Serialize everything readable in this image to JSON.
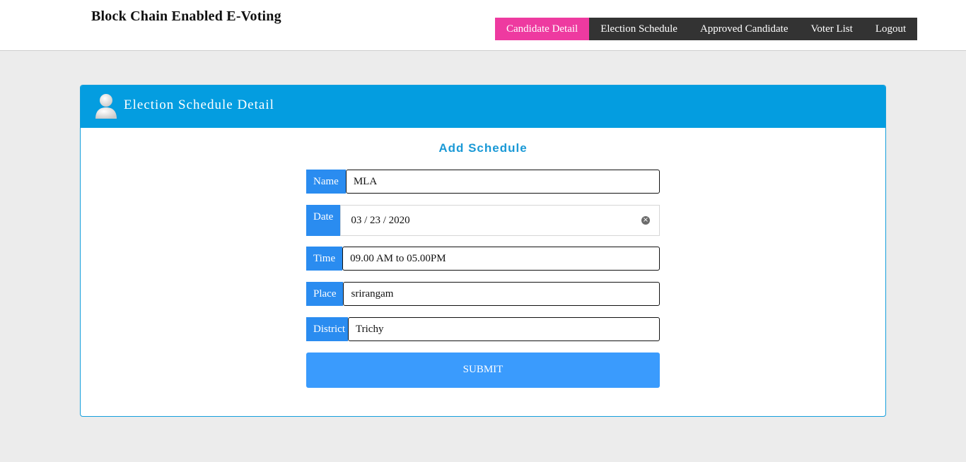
{
  "header": {
    "brand": "Block Chain Enabled E-Voting",
    "nav": [
      "Candidate Detail",
      "Election Schedule",
      "Approved Candidate",
      "Voter List",
      "Logout"
    ]
  },
  "panel": {
    "title": "Election Schedule Detail",
    "form_title": "Add Schedule",
    "fields": {
      "name": {
        "label": "Name",
        "value": "MLA"
      },
      "date": {
        "label": "Date",
        "value": "03 / 23 / 2020"
      },
      "time": {
        "label": "Time",
        "value": "09.00 AM to 05.00PM"
      },
      "place": {
        "label": "Place",
        "value": "srirangam"
      },
      "district": {
        "label": "District",
        "value": "Trichy"
      }
    },
    "submit_label": "SUBMIT"
  },
  "icons": {
    "avatar": "user-avatar-icon",
    "clear": "clear-icon"
  },
  "colors": {
    "nav_active": "#ee3aa0",
    "nav_bg": "#333333",
    "panel_header": "#049de0",
    "label_bg": "#2a8cf0",
    "submit": "#3a9bfd"
  }
}
